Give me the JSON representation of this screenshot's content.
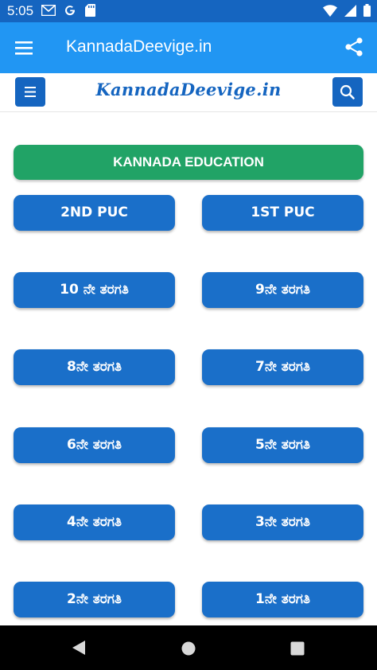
{
  "status_bar": {
    "time": "5:05",
    "left_icons": [
      "gmail-icon",
      "google-icon",
      "sd-card-icon"
    ],
    "right_icons": [
      "wifi-icon",
      "signal-icon",
      "battery-icon"
    ]
  },
  "app_bar": {
    "title": "KannadaDeevige.in",
    "left_icon": "menu-icon",
    "right_icon": "share-icon"
  },
  "site_header": {
    "logo_text": "KannadaDeevige.in",
    "left_icon": "menu-icon",
    "right_icon": "search-icon"
  },
  "banner": {
    "label": "KANNADA EDUCATION"
  },
  "grades": [
    {
      "label": "2ND PUC"
    },
    {
      "label": "1ST PUC"
    },
    {
      "label": "10 ನೇ ತರಗತಿ"
    },
    {
      "label": "9ನೇ ತರಗತಿ"
    },
    {
      "label": "8ನೇ ತರಗತಿ"
    },
    {
      "label": "7ನೇ ತರಗತಿ"
    },
    {
      "label": "6ನೇ ತರಗತಿ"
    },
    {
      "label": "5ನೇ ತರಗತಿ"
    },
    {
      "label": "4ನೇ ತರಗತಿ"
    },
    {
      "label": "3ನೇ ತರಗತಿ"
    },
    {
      "label": "2ನೇ ತರಗತಿ"
    },
    {
      "label": "1ನೇ ತರಗತಿ"
    }
  ],
  "nav_bar": {
    "icons": [
      "back-icon",
      "home-icon",
      "recents-icon"
    ]
  },
  "colors": {
    "status_bar": "#1565c0",
    "app_bar": "#2196f3",
    "banner": "#21a366",
    "grade_button": "#1a6fc9",
    "logo": "#1565c0"
  }
}
